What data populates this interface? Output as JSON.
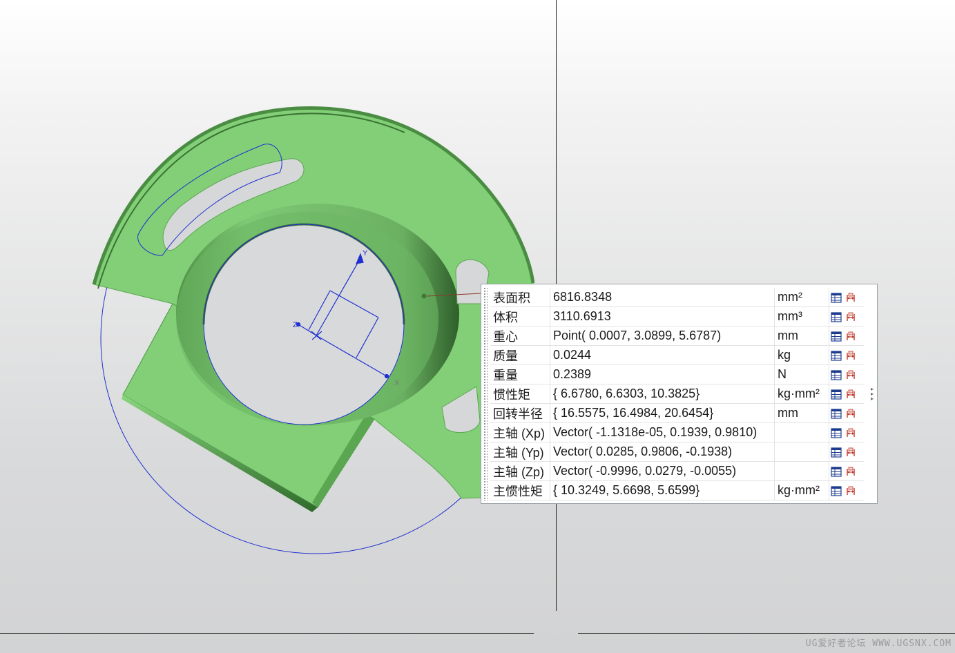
{
  "viewport": {
    "background_top": "#ffffff",
    "background_bottom": "#d2d3d4",
    "part_color": "#82cf77",
    "part_shadow": "#3f7a38",
    "wire_color": "#1f2fd1",
    "leader_color": "#8b3a2a"
  },
  "axes": {
    "x_label": "X",
    "y_label": "Y",
    "z_label": "Z"
  },
  "measurements": [
    {
      "label": "表面积",
      "value": "6816.8348",
      "unit": "mm²"
    },
    {
      "label": "体积",
      "value": "3110.6913",
      "unit": "mm³"
    },
    {
      "label": "重心",
      "value": "Point( 0.0007, 3.0899, 5.6787)",
      "unit": "mm"
    },
    {
      "label": "质量",
      "value": "0.0244",
      "unit": "kg"
    },
    {
      "label": "重量",
      "value": "0.2389",
      "unit": "N"
    },
    {
      "label": "惯性矩",
      "value": "{ 6.6780, 6.6303, 10.3825}",
      "unit": "kg·mm²"
    },
    {
      "label": "回转半径",
      "value": "{ 16.5575, 16.4984, 20.6454}",
      "unit": "mm"
    },
    {
      "label": "主轴 (Xp)",
      "value": "Vector( -1.1318e-05, 0.1939, 0.9810)",
      "unit": ""
    },
    {
      "label": "主轴 (Yp)",
      "value": "Vector( 0.0285, 0.9806, -0.1938)",
      "unit": ""
    },
    {
      "label": "主轴 (Zp)",
      "value": "Vector( -0.9996, 0.0279, -0.0055)",
      "unit": ""
    },
    {
      "label": "主惯性矩",
      "value": "{ 10.3249, 5.6698, 5.6599}",
      "unit": "kg·mm²"
    }
  ],
  "row_actions": {
    "first_icon": "spreadsheet-icon",
    "second_icon": "measure-icon"
  },
  "watermark": "UG爱好者论坛 WWW.UGSNX.COM"
}
